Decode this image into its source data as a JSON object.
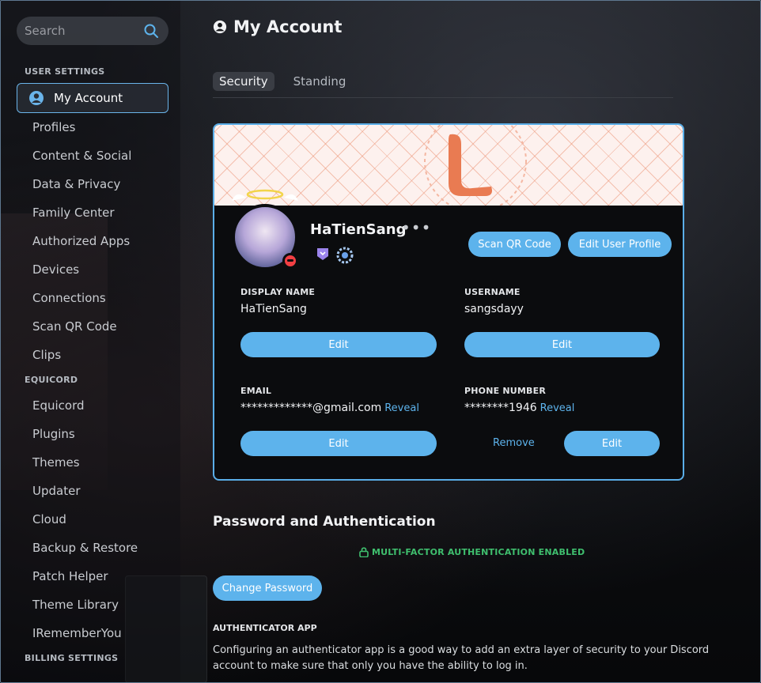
{
  "search": {
    "placeholder": "Search"
  },
  "sidebar": {
    "user_settings_header": "USER SETTINGS",
    "active_item": "My Account",
    "user_items": [
      "Profiles",
      "Content & Social",
      "Data & Privacy",
      "Family Center",
      "Authorized Apps",
      "Devices",
      "Connections",
      "Scan QR Code",
      "Clips"
    ],
    "equicord_header": "EQUICORD",
    "equicord_items": [
      "Equicord",
      "Plugins",
      "Themes",
      "Updater",
      "Cloud",
      "Backup & Restore",
      "Patch Helper",
      "Theme Library",
      "IRememberYou"
    ],
    "billing_header": "BILLING SETTINGS"
  },
  "header": {
    "title": "My Account"
  },
  "tabs": [
    {
      "label": "Security",
      "active": true
    },
    {
      "label": "Standing",
      "active": false
    }
  ],
  "profile": {
    "username_display": "HaTienSang",
    "more_label": "•••",
    "scan_qr_label": "Scan QR Code",
    "edit_profile_label": "Edit User Profile",
    "status": "dnd",
    "fields": {
      "display_name": {
        "label": "DISPLAY NAME",
        "value": "HaTienSang",
        "edit": "Edit"
      },
      "username": {
        "label": "USERNAME",
        "value": "sangsdayy",
        "edit": "Edit"
      },
      "email": {
        "label": "EMAIL",
        "value": "*************@gmail.com",
        "reveal": "Reveal",
        "edit": "Edit"
      },
      "phone": {
        "label": "PHONE NUMBER",
        "value": "********1946",
        "reveal": "Reveal",
        "remove": "Remove",
        "edit": "Edit"
      }
    }
  },
  "password_section": {
    "title": "Password and Authentication",
    "mfa_status": "MULTI-FACTOR AUTHENTICATION ENABLED",
    "change_password_label": "Change Password",
    "authenticator_title": "AUTHENTICATOR APP",
    "authenticator_desc": "Configuring an authenticator app is a good way to add an extra layer of security to your Discord account to make sure that only you have the ability to log in."
  },
  "colors": {
    "accent": "#5db3ec",
    "mfa_green": "#3fbf6e",
    "dnd_red": "#f23f43"
  }
}
